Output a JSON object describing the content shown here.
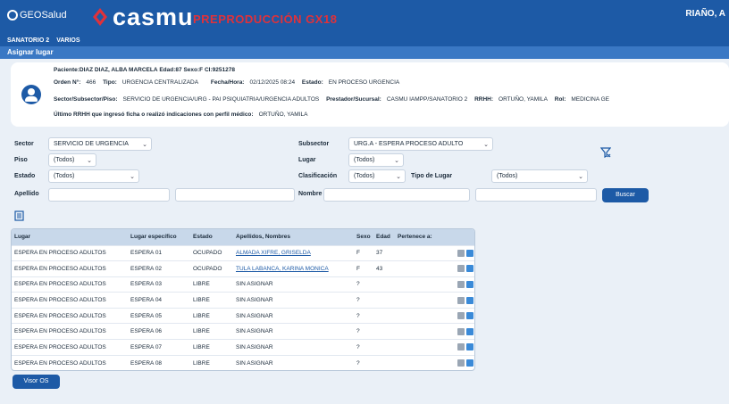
{
  "header": {
    "geo_brand": "GEOSalud",
    "brand": "casmu",
    "environment": "PREPRODUCCIÓN GX18",
    "user": "RIAÑO, A",
    "accent_color": "#1d5aa6",
    "env_color": "#e0313a"
  },
  "menu": {
    "items": [
      {
        "label": "SANATORIO 2"
      },
      {
        "label": "VARIOS"
      }
    ]
  },
  "section": {
    "title": "Asignar lugar"
  },
  "patient": {
    "paciente_label": "Paciente:",
    "paciente_value": "DIAZ DIAZ, ALBA MARCELA",
    "edad_label": "Edad:",
    "edad_value": "87",
    "sexo_label": "Sexo:",
    "sexo_value": "F",
    "ci_label": "CI:",
    "ci_value": "9251278",
    "orden_label": "Orden N°:",
    "orden_value": "466",
    "tipo_label": "Tipo:",
    "tipo_value": "URGENCIA CENTRALIZADA",
    "fecha_label": "Fecha/Hora:",
    "fecha_value": "02/12/2025 08:24",
    "estado_label": "Estado:",
    "estado_value": "EN PROCESO URGENCIA",
    "sector_label": "Sector/Subsector/Piso:",
    "sector_value": "SERVICIO DE URGENCIA/URG - PAI PSIQUIATRIA/URGENCIA ADULTOS",
    "prestador_label": "Prestador/Sucursal:",
    "prestador_value": "CASMU IAMPP/SANATORIO 2",
    "rrhh_label": "RRHH:",
    "rrhh_value": "ORTUÑO, YAMILA",
    "rol_label": "Rol:",
    "rol_value": "MEDICINA GE",
    "ultimo_label": "Último RRHH que ingresó ficha o realizó indicaciones con perfil médico:",
    "ultimo_value": "ORTUÑO, YAMILA"
  },
  "filters": {
    "sector_label": "Sector",
    "sector_value": "SERVICIO DE URGENCIA",
    "subsector_label": "Subsector",
    "subsector_value": "URG.A - ESPERA PROCESO ADULTO",
    "piso_label": "Piso",
    "piso_value": "(Todos)",
    "lugar_label": "Lugar",
    "lugar_value": "(Todos)",
    "estado_label": "Estado",
    "estado_value": "(Todos)",
    "clasificacion_label": "Clasificación",
    "clasificacion_value": "(Todos)",
    "tipo_lugar_label": "Tipo de Lugar",
    "tipo_lugar_value": "(Todos)",
    "apellido_label": "Apellido",
    "apellido_value": "",
    "apellido2_value": "",
    "nombre_label": "Nombre",
    "nombre_value": "",
    "nombre2_value": "",
    "buscar_label": "Buscar"
  },
  "table": {
    "headers": [
      "Lugar",
      "Lugar específico",
      "Estado",
      "Apellidos, Nombres",
      "Sexo",
      "Edad",
      "Pertenece a:"
    ],
    "rows": [
      {
        "lugar": "ESPERA EN PROCESO ADULTOS",
        "especifico": "ESPERA 01",
        "estado": "OCUPADO",
        "nombre": "ALMADA XIFRE, GRISELDA",
        "sexo": "F",
        "edad": "37",
        "pertenece": ""
      },
      {
        "lugar": "ESPERA EN PROCESO ADULTOS",
        "especifico": "ESPERA 02",
        "estado": "OCUPADO",
        "nombre": "TULA LABANCA, KARINA MONICA",
        "sexo": "F",
        "edad": "43",
        "pertenece": ""
      },
      {
        "lugar": "ESPERA EN PROCESO ADULTOS",
        "especifico": "ESPERA 03",
        "estado": "LIBRE",
        "nombre": "SIN ASIGNAR",
        "sexo": "?",
        "edad": "",
        "pertenece": ""
      },
      {
        "lugar": "ESPERA EN PROCESO ADULTOS",
        "especifico": "ESPERA 04",
        "estado": "LIBRE",
        "nombre": "SIN ASIGNAR",
        "sexo": "?",
        "edad": "",
        "pertenece": ""
      },
      {
        "lugar": "ESPERA EN PROCESO ADULTOS",
        "especifico": "ESPERA 05",
        "estado": "LIBRE",
        "nombre": "SIN ASIGNAR",
        "sexo": "?",
        "edad": "",
        "pertenece": ""
      },
      {
        "lugar": "ESPERA EN PROCESO ADULTOS",
        "especifico": "ESPERA 06",
        "estado": "LIBRE",
        "nombre": "SIN ASIGNAR",
        "sexo": "?",
        "edad": "",
        "pertenece": ""
      },
      {
        "lugar": "ESPERA EN PROCESO ADULTOS",
        "especifico": "ESPERA 07",
        "estado": "LIBRE",
        "nombre": "SIN ASIGNAR",
        "sexo": "?",
        "edad": "",
        "pertenece": ""
      },
      {
        "lugar": "ESPERA EN PROCESO ADULTOS",
        "especifico": "ESPERA 08",
        "estado": "LIBRE",
        "nombre": "SIN ASIGNAR",
        "sexo": "?",
        "edad": "",
        "pertenece": ""
      }
    ]
  },
  "footer": {
    "viewer_label": "Visor OS"
  }
}
